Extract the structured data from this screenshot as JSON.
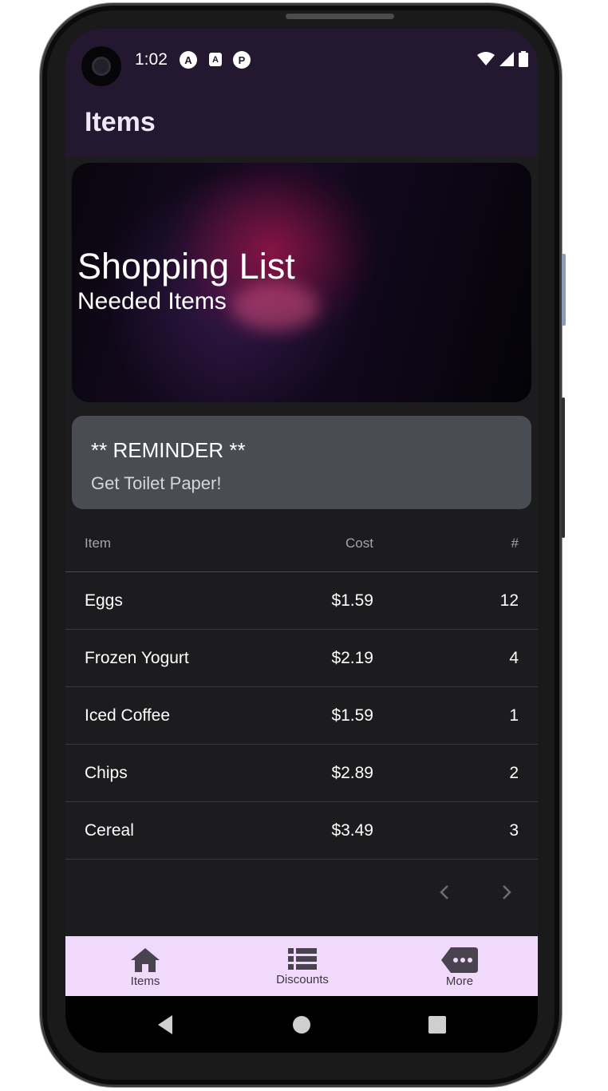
{
  "status_bar": {
    "time": "1:02",
    "app_icons": [
      "A",
      "A",
      "P"
    ]
  },
  "app_bar": {
    "title": "Items"
  },
  "hero": {
    "title": "Shopping List",
    "subtitle": "Needed Items"
  },
  "reminder": {
    "title": "** REMINDER **",
    "body": "Get Toilet Paper!"
  },
  "table": {
    "headers": {
      "item": "Item",
      "cost": "Cost",
      "qty": "#"
    },
    "rows": [
      {
        "item": "Eggs",
        "cost": "$1.59",
        "qty": "12"
      },
      {
        "item": "Frozen Yogurt",
        "cost": "$2.19",
        "qty": "4"
      },
      {
        "item": "Iced Coffee",
        "cost": "$1.59",
        "qty": "1"
      },
      {
        "item": "Chips",
        "cost": "$2.89",
        "qty": "2"
      },
      {
        "item": "Cereal",
        "cost": "$3.49",
        "qty": "3"
      }
    ]
  },
  "bottom_nav": {
    "items": [
      {
        "label": "Items",
        "icon": "home-icon"
      },
      {
        "label": "Discounts",
        "icon": "list-icon"
      },
      {
        "label": "More",
        "icon": "more-icon"
      }
    ]
  },
  "colors": {
    "app_bar": "#241831",
    "background": "#1c1c1e",
    "reminder_card": "#4a4c53",
    "bottom_nav": "#f1d9fb"
  }
}
